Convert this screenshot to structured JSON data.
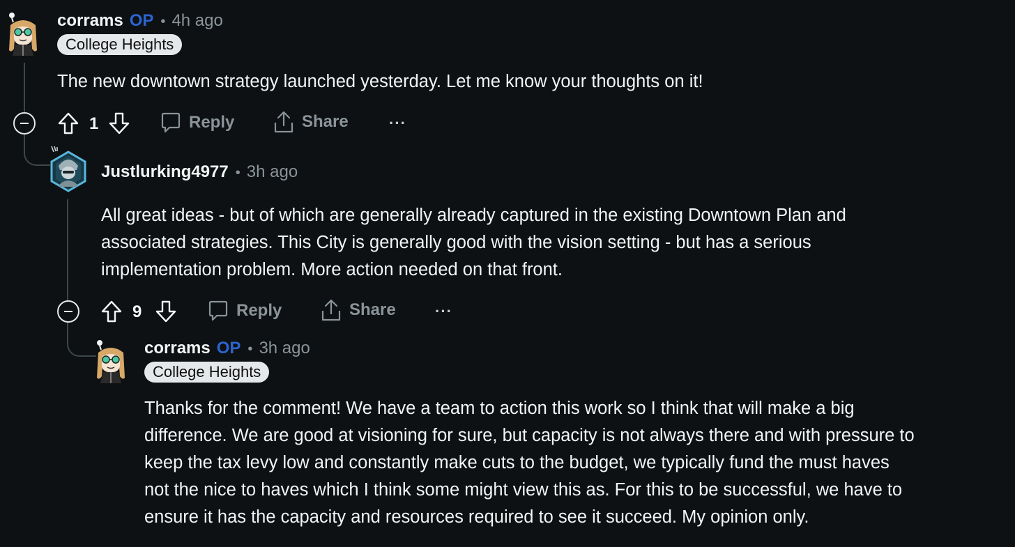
{
  "comments": [
    {
      "username": "corrams",
      "op_label": "OP",
      "separator": "•",
      "time": "4h ago",
      "flair": "College Heights",
      "body": "The new downtown strategy launched yesterday. Let me know your thoughts on it!",
      "score": "1",
      "reply_label": "Reply",
      "share_label": "Share",
      "more_label": "···"
    },
    {
      "username": "Justlurking4977",
      "separator": "•",
      "time": "3h ago",
      "body": "All great ideas - but of which are generally already captured in the existing Downtown Plan and\nassociated strategies. This City is generally good with the vision setting - but has a serious\nimplementation problem. More action needed on that front.",
      "score": "9",
      "reply_label": "Reply",
      "share_label": "Share",
      "more_label": "···"
    },
    {
      "username": "corrams",
      "op_label": "OP",
      "separator": "•",
      "time": "3h ago",
      "flair": "College Heights",
      "body": "Thanks for the comment! We have a team to action this work so I think that will make a big\ndifference. We are good at visioning for sure, but capacity is not always there and with pressure to\nkeep the tax levy low and constantly make cuts to the budget, we typically fund the must haves\nnot the nice to haves which I think some might view this as. For this to be successful, we have to\nensure it has the capacity and resources required to see it succeed. My opinion only."
    }
  ],
  "colors": {
    "background": "#0e1113",
    "op_accent": "#2c64d0",
    "muted": "#8a9499",
    "thread_line": "#3e4649",
    "flair_bg": "#e5e8ea"
  },
  "icons": [
    "avatar-corrams",
    "avatar-justlurking",
    "collapse-icon",
    "upvote-icon",
    "downvote-icon",
    "reply-icon",
    "share-icon",
    "more-icon"
  ]
}
